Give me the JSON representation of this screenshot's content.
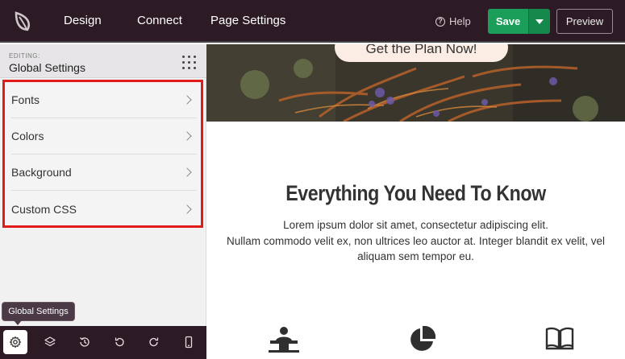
{
  "topbar": {
    "nav": [
      "Design",
      "Connect",
      "Page Settings"
    ],
    "help_label": "Help",
    "save_label": "Save",
    "preview_label": "Preview"
  },
  "sidebar": {
    "editing_label": "EDITING:",
    "editing_title": "Global Settings",
    "items": [
      {
        "label": "Fonts"
      },
      {
        "label": "Colors"
      },
      {
        "label": "Background"
      },
      {
        "label": "Custom CSS"
      }
    ],
    "tooltip": "Global Settings",
    "toolbar_icons": [
      "gear-icon",
      "layers-icon",
      "history-icon",
      "undo-icon",
      "redo-icon",
      "mobile-icon"
    ]
  },
  "canvas": {
    "cta_label": "Get the Plan Now!",
    "heading": "Everything You Need To Know",
    "body_lines": [
      "Lorem ipsum dolor sit amet, consectetur adipiscing elit.",
      "Nullam commodo velit ex, non ultrices leo auctor at. Integer blandit ex velit, vel",
      "aliquam sem tempor eu."
    ],
    "feature_icons": [
      "person-desk-icon",
      "pie-chart-icon",
      "open-book-icon"
    ]
  },
  "colors": {
    "topbar_bg": "#2c1a24",
    "save_green": "#1b9e5a",
    "highlight_red": "#e11a1a",
    "cta_bg": "#fbece4"
  }
}
